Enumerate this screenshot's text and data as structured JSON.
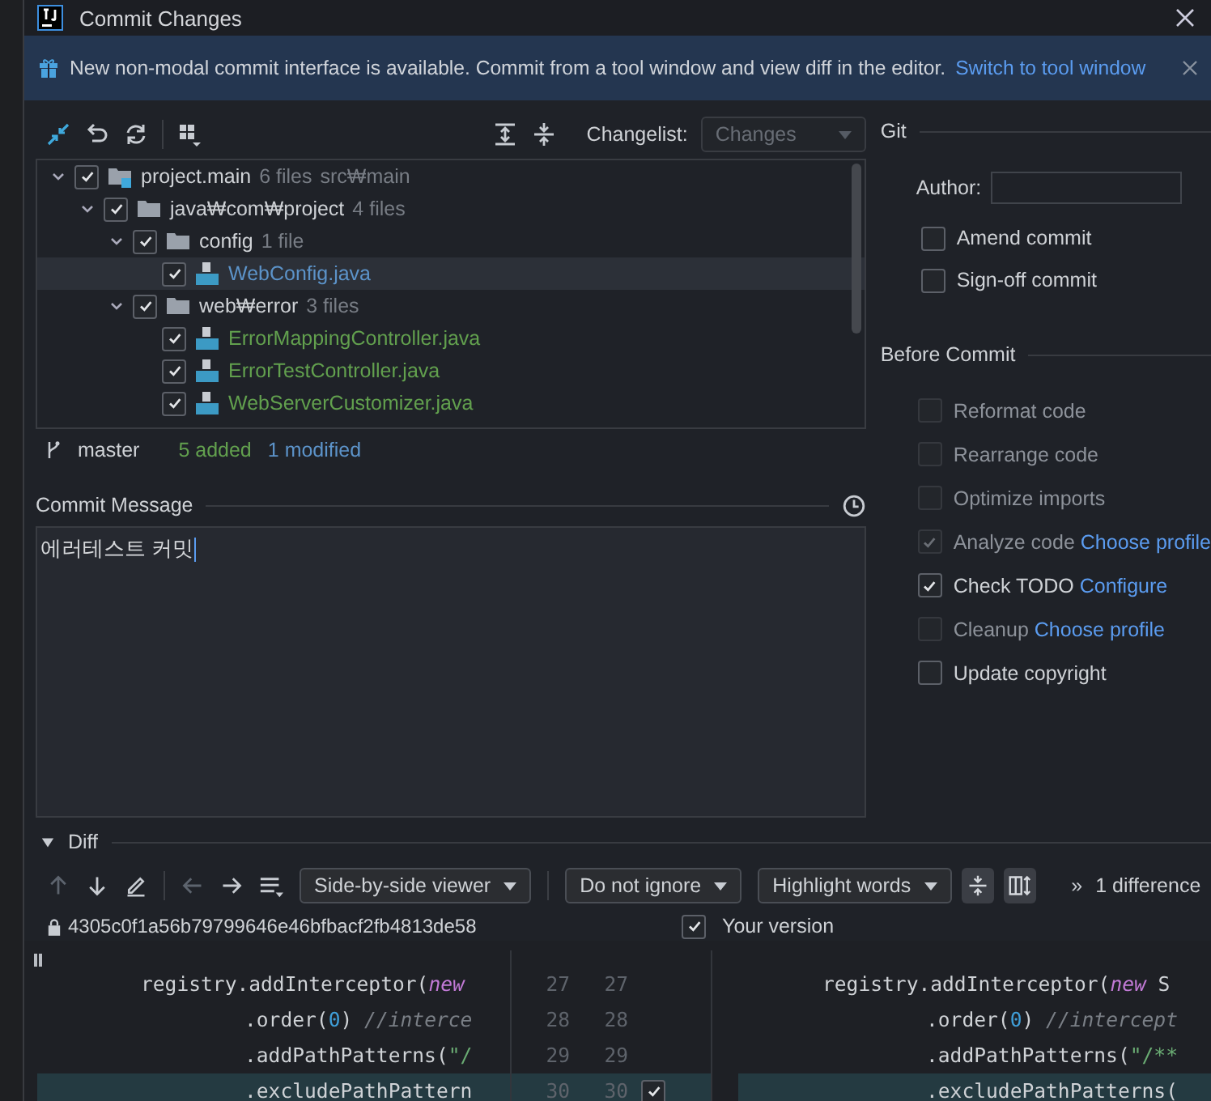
{
  "window": {
    "title": "Commit Changes"
  },
  "banner": {
    "text": "New non-modal commit interface is available. Commit from a tool window and view diff in the editor.",
    "link": "Switch to tool window"
  },
  "toolbar": {
    "changelist_label": "Changelist:",
    "changelist": "Changes"
  },
  "tree": [
    {
      "kind": "module",
      "name": "project.main",
      "count": "6 files",
      "path": "src₩main",
      "checked": true,
      "expanded": true,
      "selected": false,
      "children": [
        {
          "kind": "folder",
          "name": "java₩com₩project",
          "count": "4 files",
          "checked": true,
          "expanded": true,
          "selected": false,
          "children": [
            {
              "kind": "folder",
              "name": "config",
              "count": "1 file",
              "checked": true,
              "expanded": true,
              "selected": false,
              "children": [
                {
                  "kind": "file",
                  "name": "WebConfig.java",
                  "color": "#5c93c9",
                  "checked": true,
                  "selected": true
                }
              ]
            },
            {
              "kind": "folder",
              "name": "web₩error",
              "count": "3 files",
              "checked": true,
              "expanded": true,
              "selected": false,
              "children": [
                {
                  "kind": "file",
                  "name": "ErrorMappingController.java",
                  "color": "#62a04e",
                  "checked": true,
                  "selected": false
                },
                {
                  "kind": "file",
                  "name": "ErrorTestController.java",
                  "color": "#62a04e",
                  "checked": true,
                  "selected": false
                },
                {
                  "kind": "file",
                  "name": "WebServerCustomizer.java",
                  "color": "#62a04e",
                  "checked": true,
                  "selected": false
                }
              ]
            }
          ]
        }
      ]
    }
  ],
  "status": {
    "branch": "master",
    "added": "5 added",
    "modified": "1 modified"
  },
  "commit_message": {
    "label": "Commit Message",
    "value": "에러테스트 커밋"
  },
  "git": {
    "title": "Git",
    "author_label": "Author:",
    "options": [
      {
        "label": "Amend commit",
        "checked": false
      },
      {
        "label": "Sign-off commit",
        "checked": false
      }
    ]
  },
  "before_commit": {
    "title": "Before Commit",
    "options": [
      {
        "label": "Reformat code",
        "checked": false,
        "disabled": true
      },
      {
        "label": "Rearrange code",
        "checked": false,
        "disabled": true
      },
      {
        "label": "Optimize imports",
        "checked": false,
        "disabled": true
      },
      {
        "label": "Analyze code",
        "link": "Choose profile",
        "checked": true,
        "disabled": true
      },
      {
        "label": "Check TODO",
        "link": "Configure",
        "checked": true,
        "disabled": false
      },
      {
        "label": "Cleanup",
        "link": "Choose profile",
        "checked": false,
        "disabled": true
      },
      {
        "label": "Update copyright",
        "checked": false,
        "disabled": false
      }
    ]
  },
  "diff": {
    "title": "Diff",
    "expanded": true,
    "viewer": "Side-by-side viewer",
    "ignore": "Do not ignore",
    "highlight": "Highlight words",
    "more": "»",
    "differences": "1 difference",
    "base_revision": "4305c0f1a56b79799646e46bfbacf2fb4813de58",
    "your_version": "Your version",
    "your_version_checked": true,
    "lines": [
      {
        "kind": "statement",
        "changed": false,
        "left_number": "27",
        "right_number": "27",
        "left": [
          {
            "text": "registry.addInterceptor(",
            "kind": "plain"
          },
          {
            "text": "new",
            "kind": "keyword"
          }
        ],
        "right": [
          {
            "text": "registry.addInterceptor(",
            "kind": "plain"
          },
          {
            "text": "new",
            "kind": "keyword"
          },
          {
            "text": " S",
            "kind": "plain"
          }
        ]
      },
      {
        "kind": "continuation",
        "changed": false,
        "left_number": "28",
        "right_number": "28",
        "left": [
          {
            "text": ".order(",
            "kind": "plain"
          },
          {
            "text": "0",
            "kind": "number"
          },
          {
            "text": ") ",
            "kind": "plain"
          },
          {
            "text": "//interce",
            "kind": "comment"
          }
        ],
        "right": [
          {
            "text": ".order(",
            "kind": "plain"
          },
          {
            "text": "0",
            "kind": "number"
          },
          {
            "text": ") ",
            "kind": "plain"
          },
          {
            "text": "//intercept",
            "kind": "comment"
          }
        ]
      },
      {
        "kind": "continuation",
        "changed": false,
        "left_number": "29",
        "right_number": "29",
        "left": [
          {
            "text": ".addPathPatterns(",
            "kind": "plain"
          },
          {
            "text": "\"/",
            "kind": "string"
          }
        ],
        "right": [
          {
            "text": ".addPathPatterns(",
            "kind": "plain"
          },
          {
            "text": "\"/**",
            "kind": "string"
          }
        ]
      },
      {
        "kind": "continuation",
        "changed": true,
        "left_number": "30",
        "right_number": "30",
        "left": [
          {
            "text": ".excludePathPattern",
            "kind": "plain"
          }
        ],
        "right": [
          {
            "text": ".excludePathPatterns(",
            "kind": "plain"
          }
        ]
      }
    ]
  }
}
